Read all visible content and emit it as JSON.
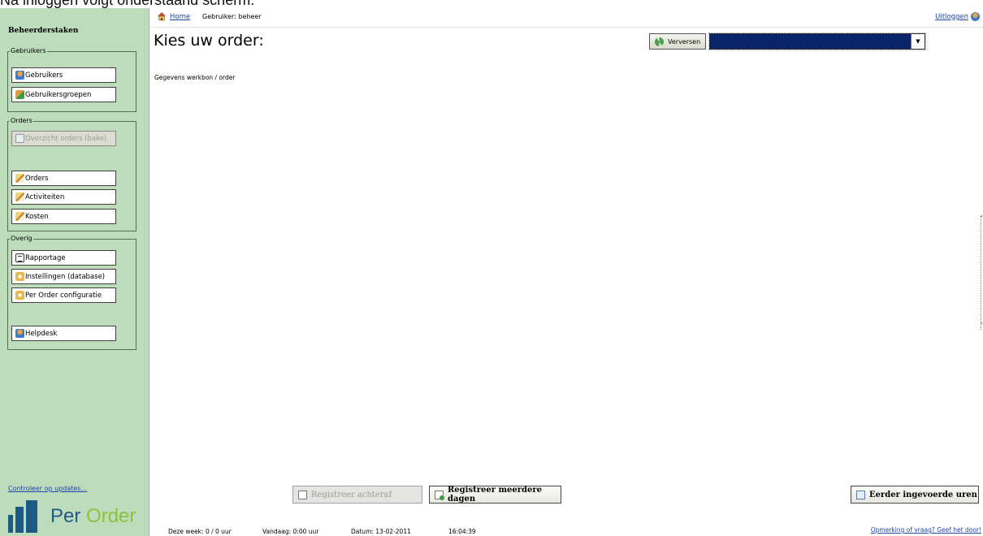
{
  "caption": "Na inloggen volgt onderstaand scherm:",
  "sidebar": {
    "title": "Beheerderstaken",
    "groups": [
      {
        "legend": "Gebruikers",
        "items": [
          {
            "label": "Gebruikers",
            "icon": "user-icon"
          },
          {
            "label": "Gebruikersgroepen",
            "icon": "user-group-icon"
          }
        ]
      },
      {
        "legend": "Orders",
        "items": [
          {
            "label": "Overzicht orders (bake)",
            "icon": "sheet-icon",
            "disabled": true
          },
          {
            "label": "Orders",
            "icon": "pencil-icon"
          },
          {
            "label": "Activiteiten",
            "icon": "pencil-icon"
          },
          {
            "label": "Kosten",
            "icon": "pencil-icon"
          }
        ]
      },
      {
        "legend": "Overig",
        "items": [
          {
            "label": "Rapportage",
            "icon": "report-icon"
          },
          {
            "label": "Instellingen (database)",
            "icon": "settings-icon"
          },
          {
            "label": "Per Order configuratie",
            "icon": "settings-icon"
          },
          {
            "label": "Helpdesk",
            "icon": "user-icon"
          }
        ]
      }
    ],
    "update_link": "Controleer op updates...",
    "logo": {
      "part1": "Per",
      "part2": "Order"
    }
  },
  "topbar": {
    "home": "Home",
    "user": "Gebruiker: beheer",
    "logout": "Uitloggen"
  },
  "main": {
    "title": "Kies uw order:",
    "refresh_label": "Verversen",
    "order_select_value": "",
    "section_label": "Gegevens werkbon / order"
  },
  "buttons": {
    "register_later": "Registreer achteraf",
    "register_multi": "Registreer meerdere dagen",
    "earlier_hours": "Eerder ingevoerde uren"
  },
  "status": {
    "week": "Deze week: 0 / 0 uur",
    "today": "Vandaag: 0:00 uur",
    "date": "Datum: 13-02-2011",
    "time": "16:04:39",
    "feedback": "Opmerking of vraag? Geef het door!"
  },
  "colors": {
    "sidebar_bg": "#bcdcbc",
    "select_bg": "#0a246a",
    "link": "#2244aa",
    "logo_blue": "#1e5a86",
    "logo_green": "#8cc23c"
  }
}
